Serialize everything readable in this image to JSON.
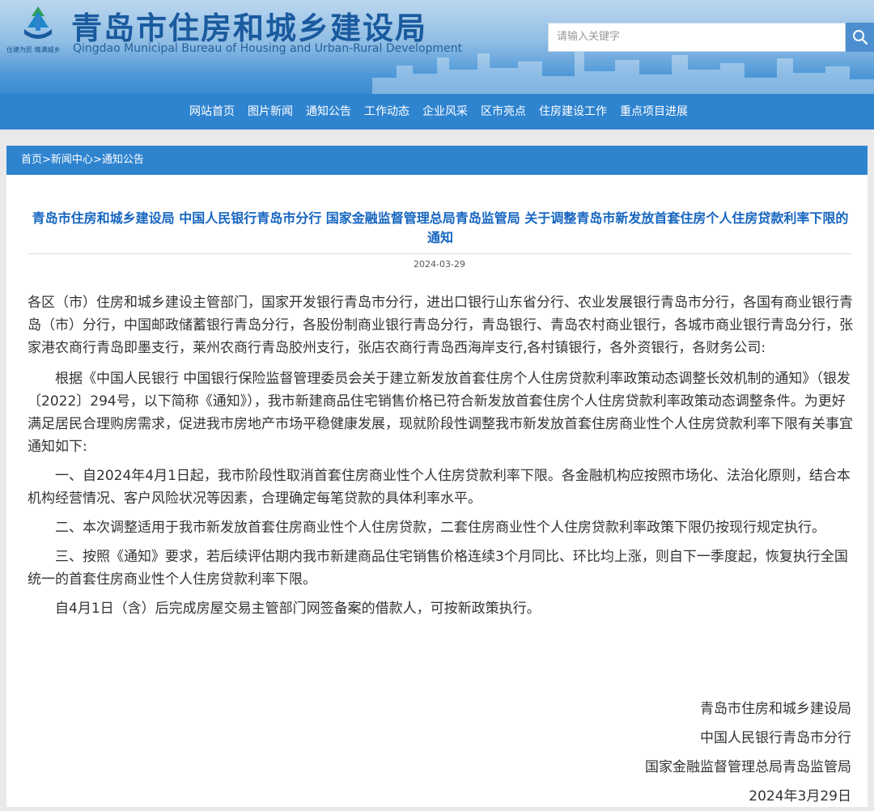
{
  "header": {
    "site_title": "青岛市住房和城乡建设局",
    "site_subtitle": "Qingdao Municipal Bureau of Housing and Urban-Rural Development",
    "logo_slogan": "住建为民 情满城乡",
    "search_placeholder": "请输入关键字",
    "logo_icon": "emblem-icon",
    "search_icon": "search-icon"
  },
  "nav": {
    "items": [
      {
        "label": "网站首页"
      },
      {
        "label": "图片新闻"
      },
      {
        "label": "通知公告"
      },
      {
        "label": "工作动态"
      },
      {
        "label": "企业风采"
      },
      {
        "label": "区市亮点"
      },
      {
        "label": "住房建设工作"
      },
      {
        "label": "重点项目进展"
      }
    ]
  },
  "breadcrumb": {
    "home": "首页",
    "sep1": ">",
    "news": "新闻中心",
    "sep2": ">",
    "current": "通知公告"
  },
  "article": {
    "title": "青岛市住房和城乡建设局 中国人民银行青岛市分行 国家金融监督管理总局青岛监管局 关于调整青岛市新发放首套住房个人住房贷款利率下限的通知",
    "date": "2024-03-29",
    "paragraphs": [
      "各区（市）住房和城乡建设主管部门，国家开发银行青岛市分行，进出口银行山东省分行、农业发展银行青岛市分行，各国有商业银行青岛（市）分行，中国邮政储蓄银行青岛分行，各股份制商业银行青岛分行，青岛银行、青岛农村商业银行，各城市商业银行青岛分行，张家港农商行青岛即墨支行，莱州农商行青岛胶州支行，张店农商行青岛西海岸支行,各村镇银行，各外资银行，各财务公司:",
      "根据《中国人民银行 中国银行保险监督管理委员会关于建立新发放首套住房个人住房贷款利率政策动态调整长效机制的通知》（银发〔2022〕294号，以下简称《通知》），我市新建商品住宅销售价格已符合新发放首套住房个人住房贷款利率政策动态调整条件。为更好满足居民合理购房需求，促进我市房地产市场平稳健康发展，现就阶段性调整我市新发放首套住房商业性个人住房贷款利率下限有关事宜通知如下:",
      "一、自2024年4月1日起，我市阶段性取消首套住房商业性个人住房贷款利率下限。各金融机构应按照市场化、法治化原则，结合本机构经营情况、客户风险状况等因素，合理确定每笔贷款的具体利率水平。",
      "二、本次调整适用于我市新发放首套住房商业性个人住房贷款，二套住房商业性个人住房贷款利率政策下限仍按现行规定执行。",
      "三、按照《通知》要求，若后续评估期内我市新建商品住宅销售价格连续3个月同比、环比均上涨，则自下一季度起，恢复执行全国统一的首套住房商业性个人住房贷款利率下限。",
      "自4月1日（含）后完成房屋交易主管部门网签备案的借款人，可按新政策执行。"
    ],
    "signature": {
      "org1": "青岛市住房和城乡建设局",
      "org2": "中国人民银行青岛市分行",
      "org3": "国家金融监督管理总局青岛监管局",
      "date": "2024年3月29日"
    }
  }
}
